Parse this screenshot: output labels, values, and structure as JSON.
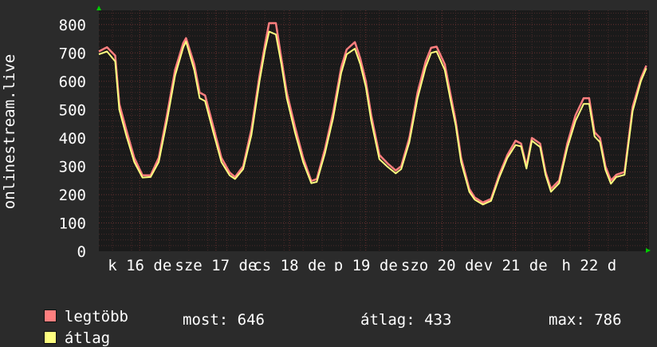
{
  "chart_data": {
    "type": "line",
    "ylabel": "onlinestream.live",
    "ylim": [
      0,
      850
    ],
    "yticks": [
      0,
      100,
      200,
      300,
      400,
      500,
      600,
      700,
      800
    ],
    "xlim": [
      0,
      19
    ],
    "grid": true,
    "colors": {
      "background": "#2b2b2b",
      "plot": "#1a1a1a",
      "grid_minor": "#4a2a2a",
      "grid_major": "#6a3030",
      "axis_arrow": "#00cc00"
    },
    "xticks": [
      {
        "x": 1.5,
        "label": "k 16 de"
      },
      {
        "x": 4.3,
        "label": "sze 17 de"
      },
      {
        "x": 7.0,
        "label": "cs 18 de"
      },
      {
        "x": 9.8,
        "label": "p 19 de"
      },
      {
        "x": 12.6,
        "label": "szo 20 de"
      },
      {
        "x": 15.3,
        "label": "v 21 de"
      },
      {
        "x": 18.0,
        "label": "h 22 d"
      }
    ],
    "series": [
      {
        "name": "legtöbb",
        "color": "#ff7f7f",
        "points": [
          [
            0,
            705
          ],
          [
            0.3,
            720
          ],
          [
            0.6,
            690
          ],
          [
            0.75,
            520
          ],
          [
            1.0,
            430
          ],
          [
            1.3,
            330
          ],
          [
            1.6,
            268
          ],
          [
            1.9,
            268
          ],
          [
            2.2,
            330
          ],
          [
            2.5,
            480
          ],
          [
            2.8,
            640
          ],
          [
            3.1,
            735
          ],
          [
            3.2,
            752
          ],
          [
            3.5,
            660
          ],
          [
            3.7,
            560
          ],
          [
            3.9,
            550
          ],
          [
            4.2,
            440
          ],
          [
            4.5,
            330
          ],
          [
            4.8,
            278
          ],
          [
            5.0,
            262
          ],
          [
            5.3,
            300
          ],
          [
            5.6,
            430
          ],
          [
            5.9,
            620
          ],
          [
            6.1,
            730
          ],
          [
            6.25,
            805
          ],
          [
            6.5,
            805
          ],
          [
            6.7,
            680
          ],
          [
            6.9,
            560
          ],
          [
            7.2,
            440
          ],
          [
            7.5,
            330
          ],
          [
            7.8,
            248
          ],
          [
            8.0,
            255
          ],
          [
            8.3,
            360
          ],
          [
            8.6,
            490
          ],
          [
            8.9,
            650
          ],
          [
            9.1,
            712
          ],
          [
            9.4,
            738
          ],
          [
            9.6,
            680
          ],
          [
            9.8,
            600
          ],
          [
            10.0,
            480
          ],
          [
            10.3,
            340
          ],
          [
            10.6,
            310
          ],
          [
            10.9,
            285
          ],
          [
            11.1,
            300
          ],
          [
            11.4,
            400
          ],
          [
            11.7,
            560
          ],
          [
            12.0,
            670
          ],
          [
            12.2,
            718
          ],
          [
            12.4,
            722
          ],
          [
            12.7,
            660
          ],
          [
            12.9,
            560
          ],
          [
            13.1,
            460
          ],
          [
            13.3,
            330
          ],
          [
            13.6,
            220
          ],
          [
            13.8,
            190
          ],
          [
            14.1,
            172
          ],
          [
            14.4,
            185
          ],
          [
            14.7,
            270
          ],
          [
            15.0,
            340
          ],
          [
            15.3,
            390
          ],
          [
            15.5,
            380
          ],
          [
            15.7,
            300
          ],
          [
            15.9,
            400
          ],
          [
            16.2,
            380
          ],
          [
            16.4,
            280
          ],
          [
            16.6,
            220
          ],
          [
            16.9,
            250
          ],
          [
            17.2,
            380
          ],
          [
            17.5,
            480
          ],
          [
            17.8,
            540
          ],
          [
            18.0,
            540
          ],
          [
            18.2,
            420
          ],
          [
            18.4,
            400
          ],
          [
            18.6,
            300
          ],
          [
            18.8,
            250
          ],
          [
            19.0,
            270
          ],
          [
            19.3,
            280
          ],
          [
            19.6,
            510
          ],
          [
            19.9,
            610
          ],
          [
            20.1,
            655
          ]
        ]
      },
      {
        "name": "átlag",
        "color": "#ffff80",
        "points": [
          [
            0,
            695
          ],
          [
            0.3,
            705
          ],
          [
            0.6,
            670
          ],
          [
            0.75,
            500
          ],
          [
            1.0,
            410
          ],
          [
            1.3,
            315
          ],
          [
            1.6,
            260
          ],
          [
            1.9,
            262
          ],
          [
            2.2,
            315
          ],
          [
            2.5,
            460
          ],
          [
            2.8,
            620
          ],
          [
            3.1,
            720
          ],
          [
            3.2,
            740
          ],
          [
            3.5,
            640
          ],
          [
            3.7,
            540
          ],
          [
            3.9,
            530
          ],
          [
            4.2,
            420
          ],
          [
            4.5,
            315
          ],
          [
            4.8,
            268
          ],
          [
            5.0,
            255
          ],
          [
            5.3,
            290
          ],
          [
            5.6,
            410
          ],
          [
            5.9,
            600
          ],
          [
            6.1,
            710
          ],
          [
            6.25,
            775
          ],
          [
            6.5,
            765
          ],
          [
            6.7,
            660
          ],
          [
            6.9,
            540
          ],
          [
            7.2,
            420
          ],
          [
            7.5,
            315
          ],
          [
            7.8,
            240
          ],
          [
            8.0,
            245
          ],
          [
            8.3,
            345
          ],
          [
            8.6,
            470
          ],
          [
            8.9,
            630
          ],
          [
            9.1,
            695
          ],
          [
            9.4,
            715
          ],
          [
            9.6,
            660
          ],
          [
            9.8,
            580
          ],
          [
            10.0,
            460
          ],
          [
            10.3,
            325
          ],
          [
            10.6,
            298
          ],
          [
            10.9,
            275
          ],
          [
            11.1,
            290
          ],
          [
            11.4,
            385
          ],
          [
            11.7,
            540
          ],
          [
            12.0,
            650
          ],
          [
            12.2,
            700
          ],
          [
            12.4,
            705
          ],
          [
            12.7,
            640
          ],
          [
            12.9,
            540
          ],
          [
            13.1,
            445
          ],
          [
            13.3,
            315
          ],
          [
            13.6,
            210
          ],
          [
            13.8,
            182
          ],
          [
            14.1,
            165
          ],
          [
            14.4,
            178
          ],
          [
            14.7,
            260
          ],
          [
            15.0,
            330
          ],
          [
            15.3,
            375
          ],
          [
            15.5,
            370
          ],
          [
            15.7,
            292
          ],
          [
            15.9,
            390
          ],
          [
            16.2,
            368
          ],
          [
            16.4,
            270
          ],
          [
            16.6,
            210
          ],
          [
            16.9,
            240
          ],
          [
            17.2,
            365
          ],
          [
            17.5,
            460
          ],
          [
            17.8,
            520
          ],
          [
            18.0,
            520
          ],
          [
            18.2,
            405
          ],
          [
            18.4,
            385
          ],
          [
            18.6,
            288
          ],
          [
            18.8,
            238
          ],
          [
            19.0,
            262
          ],
          [
            19.3,
            270
          ],
          [
            19.6,
            495
          ],
          [
            19.9,
            600
          ],
          [
            20.1,
            646
          ]
        ]
      }
    ]
  },
  "legend": [
    {
      "label": "legtöbb",
      "color": "#ff7f7f"
    },
    {
      "label": "átlag",
      "color": "#ffff80"
    }
  ],
  "stats": {
    "most": "most: 646",
    "atlag": "átlag: 433",
    "max": "max: 786"
  }
}
